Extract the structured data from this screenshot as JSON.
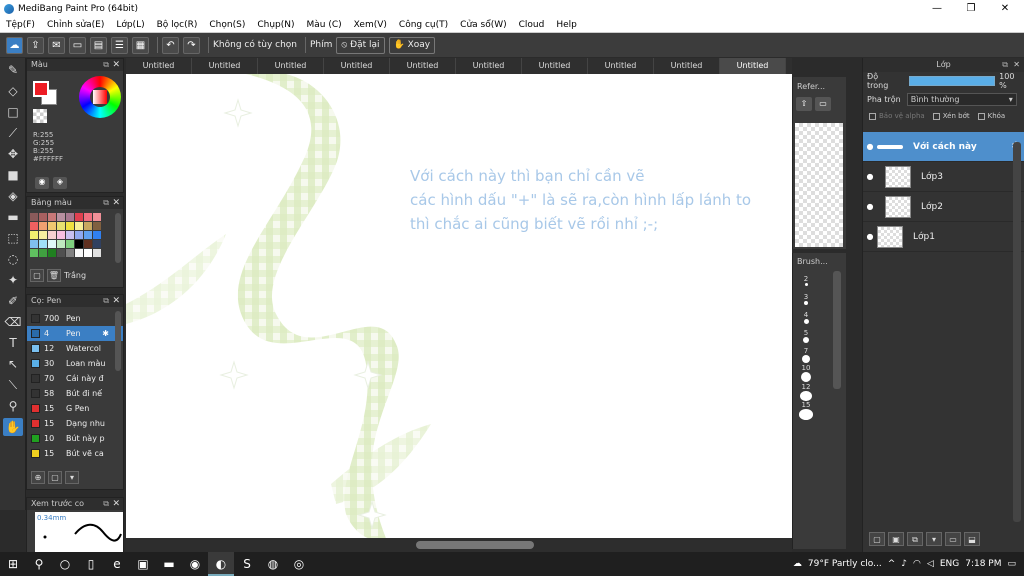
{
  "window": {
    "title": "MediBang Paint Pro (64bit)"
  },
  "menu": [
    "Tệp(F)",
    "Chỉnh sửa(E)",
    "Lớp(L)",
    "Bộ lọc(R)",
    "Chọn(S)",
    "Chụp(N)",
    "Màu (C)",
    "Xem(V)",
    "Công cụ(T)",
    "Cửa sổ(W)",
    "Cloud",
    "Help"
  ],
  "toolbar": {
    "selection_text": "Không có tùy chọn",
    "key_label": "Phím",
    "reset_label": "Đặt lại",
    "rotate_label": "Xoay"
  },
  "color_panel": {
    "title": "Màu",
    "r": "R:255",
    "g": "G:255",
    "b": "B:255",
    "hex": "#FFFFFF"
  },
  "palette_panel": {
    "title": "Bảng màu",
    "color_name": "Trắng",
    "colors": [
      "#8a5a5a",
      "#a86060",
      "#c87878",
      "#b890a0",
      "#a87890",
      "#e04050",
      "#f07080",
      "#f09098",
      "#f06060",
      "#f0a070",
      "#f0c870",
      "#e8e070",
      "#f0e040",
      "#f8f098",
      "#c8a860",
      "#806040",
      "#f0f070",
      "#f8f0a0",
      "#f8d0d0",
      "#f8c0e0",
      "#c8c0f0",
      "#90a8f0",
      "#60a0f0",
      "#3080f0",
      "#80c0f0",
      "#a0e0f8",
      "#e0f8f8",
      "#c0e8c0",
      "#80d080",
      "#000000",
      "#603020",
      "#304060",
      "#60c060",
      "#40a040",
      "#208020",
      "#505050",
      "#808080",
      "#f8f8f8",
      "#ffffff",
      "#e0e0e0"
    ]
  },
  "brush_panel": {
    "title": "Cọ: Pen",
    "brushes": [
      {
        "size": "700",
        "name": "Pen",
        "color": "#333333"
      },
      {
        "size": "4",
        "name": "Pen",
        "color": "#2a6aa8"
      },
      {
        "size": "12",
        "name": "Watercol",
        "color": "#7ac0f0"
      },
      {
        "size": "30",
        "name": "Loan màu",
        "color": "#5ab0e8"
      },
      {
        "size": "70",
        "name": "Cái này đ",
        "color": "#333333"
      },
      {
        "size": "58",
        "name": "Bút đi nế",
        "color": "#333333"
      },
      {
        "size": "15",
        "name": "G Pen",
        "color": "#e03030"
      },
      {
        "size": "15",
        "name": "Dạng nhu",
        "color": "#e03030"
      },
      {
        "size": "10",
        "name": "Bút này p",
        "color": "#20a020"
      },
      {
        "size": "15",
        "name": "Bút vẽ ca",
        "color": "#f0d020"
      }
    ]
  },
  "preview_panel": {
    "title": "Xem trước co",
    "size": "0.34mm"
  },
  "tabs": [
    "Untitled",
    "Untitled",
    "Untitled",
    "Untitled",
    "Untitled",
    "Untitled",
    "Untitled",
    "Untitled",
    "Untitled",
    "Untitled"
  ],
  "canvas": {
    "note_lines": [
      "Với cách này thì bạn chỉ cần vẽ",
      "các hình dấu \"+\" là sẽ ra,còn hình lấp lánh to",
      " thì chắc ai cũng biết vẽ rồi nhỉ ;-;"
    ]
  },
  "reference_panel": {
    "title": "Refer..."
  },
  "brush_size_panel": {
    "title": "Brush...",
    "sizes": [
      "2",
      "3",
      "4",
      "5",
      "7",
      "10",
      "12",
      "15"
    ]
  },
  "layer_panel": {
    "title": "Lớp",
    "opacity_label": "Độ trong",
    "opacity_value": "100 %",
    "opacity": 100,
    "blend_label": "Pha trộn",
    "blend_value": "Bình thường",
    "protect_alpha": "Bảo vệ alpha",
    "clipping": "Xén bớt",
    "lock": "Khóa",
    "layers": [
      {
        "name": "Với cách này",
        "selected": true
      },
      {
        "name": "Lớp3",
        "selected": false
      },
      {
        "name": "Lớp2",
        "selected": false
      },
      {
        "name": "Lớp1",
        "selected": false
      }
    ]
  },
  "taskbar": {
    "weather": "79°F  Partly clo...",
    "lang": "ENG",
    "time": "7:18 PM"
  }
}
